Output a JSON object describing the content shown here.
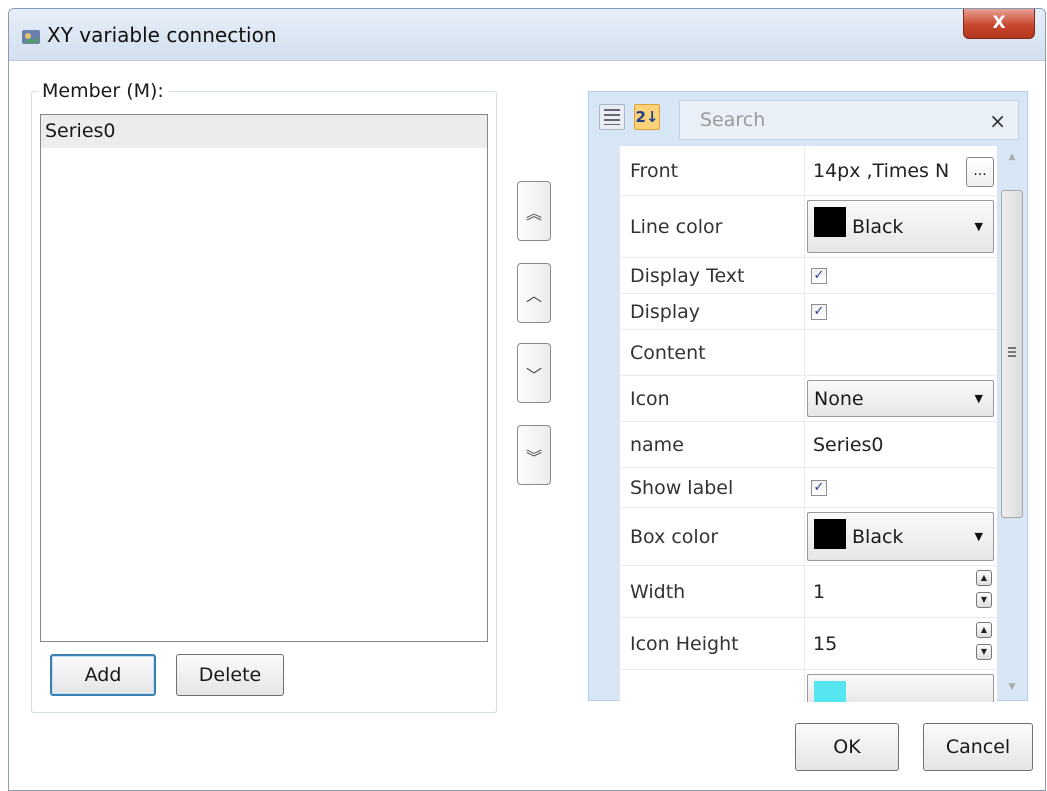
{
  "window": {
    "title": "XY variable connection",
    "close_label": "X"
  },
  "member_group": {
    "label": "Member (M):",
    "items": [
      "Series0"
    ],
    "add_label": "Add",
    "delete_label": "Delete"
  },
  "move_buttons": {
    "top": "︽",
    "up": "︿",
    "down": "﹀",
    "bottom": "︾"
  },
  "property_panel": {
    "search_placeholder": "Search",
    "search_clear": "×",
    "sort_icon_label": "2↓",
    "rows": {
      "font": {
        "label": "Front",
        "value": "14px ,Times N",
        "button": "..."
      },
      "line_color": {
        "label": "Line color",
        "value": "Black",
        "swatch": "#000000"
      },
      "display_text": {
        "label": "Display Text",
        "checked": true
      },
      "display": {
        "label": "Display",
        "checked": true
      },
      "content": {
        "label": "Content",
        "value": ""
      },
      "icon": {
        "label": "Icon",
        "value": "None"
      },
      "name": {
        "label": "name",
        "value": "Series0"
      },
      "show_label": {
        "label": "Show label",
        "checked": true
      },
      "box_color": {
        "label": "Box color",
        "value": "Black",
        "swatch": "#000000"
      },
      "width": {
        "label": "Width",
        "value": "1"
      },
      "icon_height": {
        "label": "Icon Height",
        "value": "15"
      },
      "partial": {
        "label": "",
        "swatch": "#55e6f2"
      }
    },
    "check_mark": "✓",
    "dropdown_arrow": "▼",
    "spin_up": "▲",
    "spin_down": "▼",
    "scroll_up": "▲",
    "scroll_down": "▼"
  },
  "dialog_buttons": {
    "ok_label": "OK",
    "cancel_label": "Cancel"
  }
}
